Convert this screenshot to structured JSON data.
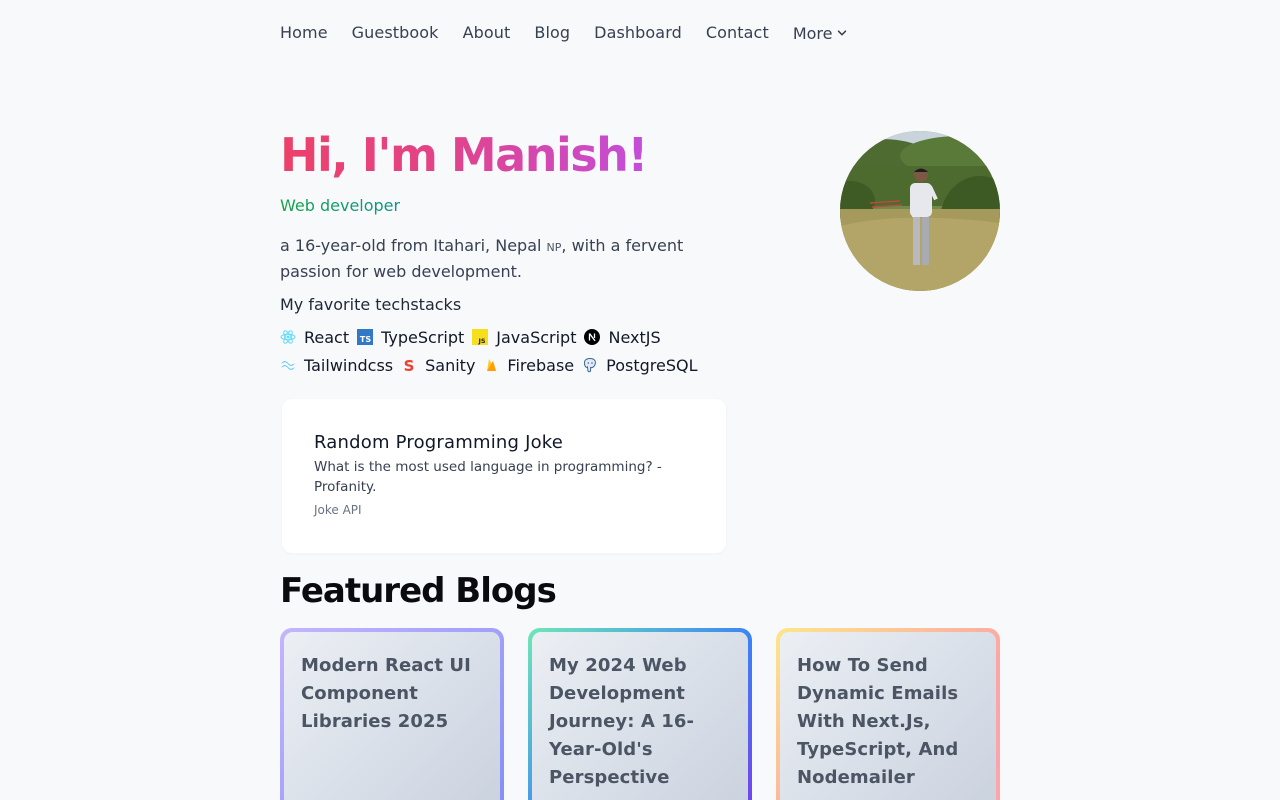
{
  "nav": {
    "items": [
      "Home",
      "Guestbook",
      "About",
      "Blog",
      "Dashboard",
      "Contact"
    ],
    "more_label": "More"
  },
  "hero": {
    "title": "Hi, I'm Manish!",
    "role": "Web developer",
    "bio_before": "a 16-year-old from Itahari, Nepal ",
    "bio_country": "NP",
    "bio_after": ", with a fervent passion for web development."
  },
  "techstack": {
    "heading": "My favorite techstacks",
    "items": [
      {
        "label": "React",
        "icon": "react-icon"
      },
      {
        "label": "TypeScript",
        "icon": "typescript-icon"
      },
      {
        "label": "JavaScript",
        "icon": "javascript-icon"
      },
      {
        "label": "NextJS",
        "icon": "nextjs-icon"
      },
      {
        "label": "Tailwindcss",
        "icon": "tailwind-icon"
      },
      {
        "label": "Sanity",
        "icon": "sanity-icon"
      },
      {
        "label": "Firebase",
        "icon": "firebase-icon"
      },
      {
        "label": "PostgreSQL",
        "icon": "postgresql-icon"
      }
    ]
  },
  "joke": {
    "title": "Random Programming Joke",
    "text": "What is the most used language in programming? - Profanity.",
    "source": "Joke API"
  },
  "featured": {
    "title": "Featured Blogs",
    "posts": [
      {
        "title": "Modern React UI Component Libraries 2025"
      },
      {
        "title": "My 2024 Web Development Journey: A 16-Year-Old's Perspective"
      },
      {
        "title": "How To Send Dynamic Emails With Next.Js, TypeScript, And Nodemailer"
      }
    ]
  },
  "colors": {
    "title_gradient_start": "#ec4169",
    "title_gradient_end": "#c44ddb",
    "role_green": "#16a34a",
    "page_bg": "#f8f9fb"
  }
}
